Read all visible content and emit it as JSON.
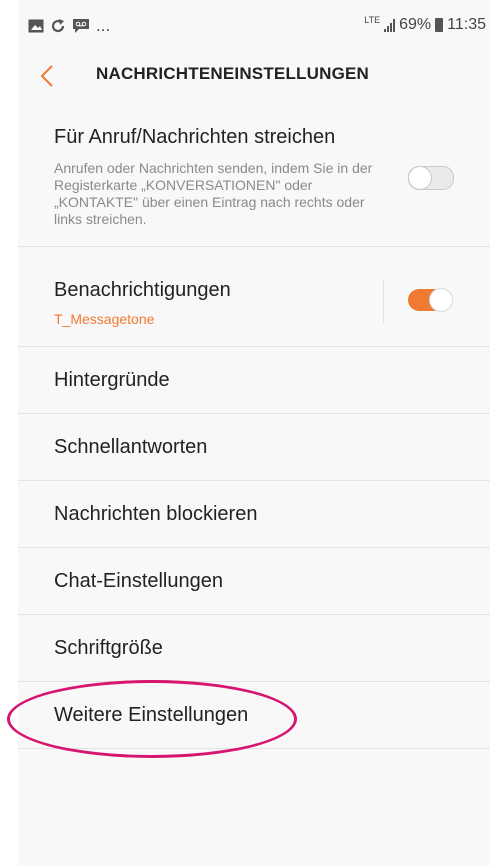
{
  "status_bar": {
    "left_icons": [
      "image-icon",
      "sync-icon",
      "voicemail-icon"
    ],
    "ellipsis": "...",
    "network": "LTE",
    "battery": "69%",
    "time": "11:35"
  },
  "header": {
    "back_glyph": "<",
    "title": "NACHRICHTENEINSTELLUNGEN"
  },
  "settings": {
    "swipe": {
      "title": "Für Anruf/Nachrichten streichen",
      "description": "Anrufen oder Nachrichten senden, indem Sie in der Registerkarte „KONVERSATIONEN\" oder „KONTAKTE\" über einen Eintrag nach rechts oder links streichen.",
      "enabled": false
    },
    "notifications": {
      "title": "Benachrichtigungen",
      "subtitle": "T_Messagetone",
      "enabled": true
    },
    "items": [
      "Hintergründe",
      "Schnellantworten",
      "Nachrichten blockieren",
      "Chat-Einstellungen",
      "Schriftgröße",
      "Weitere Einstellungen"
    ]
  },
  "colors": {
    "accent": "#f07a31",
    "annotation": "#d6166f"
  }
}
